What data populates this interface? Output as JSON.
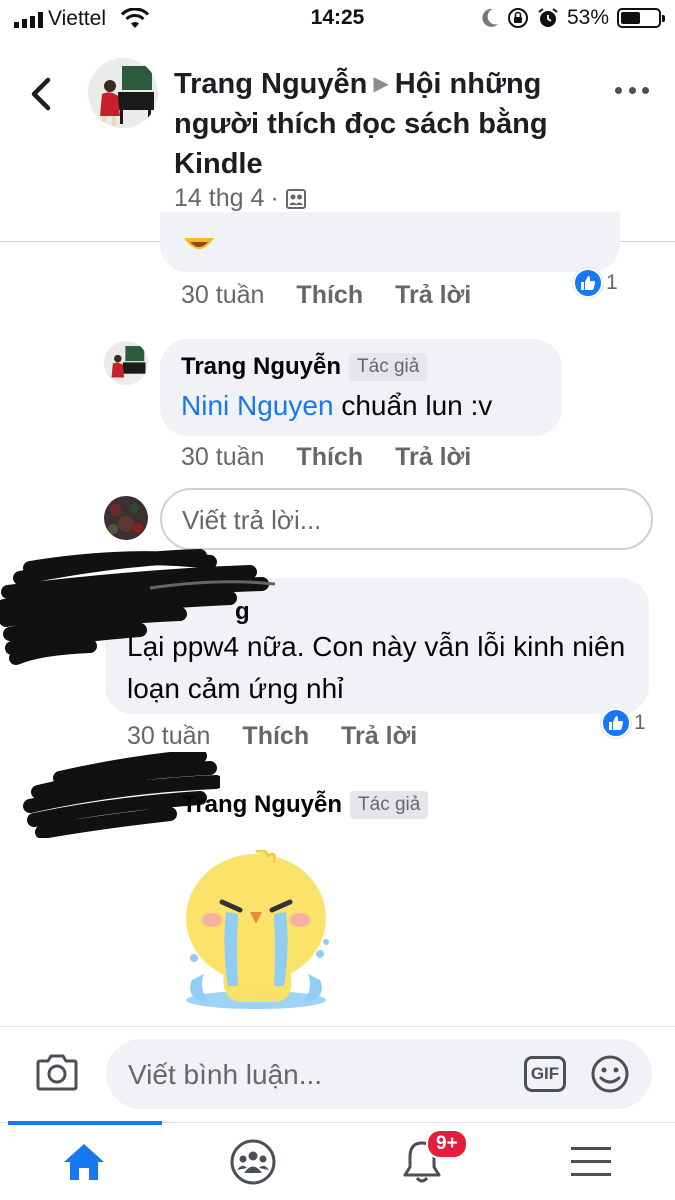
{
  "status_bar": {
    "carrier": "Viettel",
    "time": "14:25",
    "battery": "53%",
    "battery_level": 0.53
  },
  "header": {
    "author": "Trang Nguyễn",
    "group": "Hội những người thích đọc sách bằng Kindle",
    "date": "14 thg 4",
    "separator": "·",
    "privacy_icon": "group-members-icon"
  },
  "comments": [
    {
      "time": "30 tuần",
      "like_label": "Thích",
      "reply_label": "Trả lời",
      "reaction_count": "1"
    },
    {
      "author": "Trang Nguyễn",
      "badge": "Tác giả",
      "mention": "Nini Nguyen",
      "text": "chuẩn lun :v",
      "time": "30 tuần",
      "like_label": "Thích",
      "reply_label": "Trả lời"
    },
    {
      "author_fragment": "g",
      "text": "Lại ppw4 nữa. Con này vẫn lỗi kinh niên loạn cảm ứng nhỉ",
      "time": "30 tuần",
      "like_label": "Thích",
      "reply_label": "Trả lời",
      "reaction_count": "1"
    },
    {
      "author": "Trang Nguyễn",
      "badge": "Tác giả",
      "sticker": "crying-chick-sticker"
    }
  ],
  "reply_input": {
    "placeholder": "Viết trả lời..."
  },
  "composer": {
    "placeholder": "Viết bình luận...",
    "gif_label": "GIF"
  },
  "bottom_nav": {
    "notifications_badge": "9+",
    "items": [
      "home-icon",
      "groups-icon",
      "notifications-icon",
      "menu-icon"
    ]
  },
  "colors": {
    "accent": "#1877f2",
    "bubble": "#f0f2f5",
    "secondary_text": "#65676b",
    "badge": "#e41e3f"
  }
}
